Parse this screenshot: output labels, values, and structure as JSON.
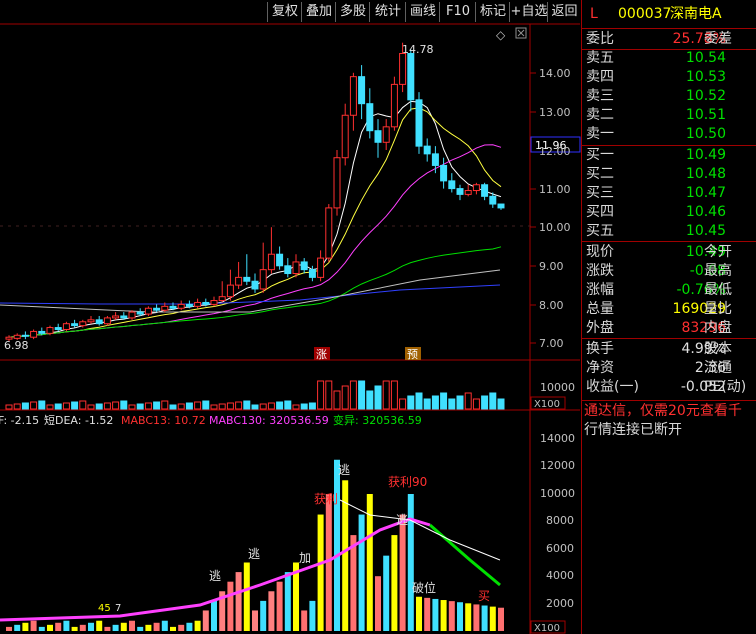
{
  "toolbar": {
    "buttons": [
      "复权",
      "叠加",
      "多股",
      "统计",
      "画线",
      "F10",
      "标记",
      "+自选",
      "返回"
    ]
  },
  "main_chart": {
    "high_label": "14.78",
    "low_label": "6.98",
    "current_price_tag": "11.96",
    "y_ticks": [
      "14.00",
      "13.00",
      "12.00",
      "11.00",
      "10.00",
      "9.00",
      "8.00",
      "7.00"
    ],
    "markers": [
      "涨",
      "预"
    ],
    "diamond": "◇"
  },
  "volume_chart": {
    "y_tick": "10000",
    "unit": "X100"
  },
  "indicator_chart": {
    "header": [
      "F: -2.15",
      "短DEA: -1.52",
      "MABC13: 10.72",
      "MABC130: 320536.59",
      "变异: 320536.59"
    ],
    "y_ticks": [
      "14000",
      "12000",
      "10000",
      "8000",
      "6000",
      "4000",
      "2000"
    ],
    "unit": "X100",
    "annotations": [
      "逃",
      "逃",
      "逃",
      "逃",
      "获利",
      "获利90",
      "加",
      "破位",
      "买",
      "45",
      "7"
    ]
  },
  "quote": {
    "header_letter": "L",
    "code": "000037",
    "name": "深南电A",
    "wei_bi_label": "委比",
    "wei_bi": "25.78%",
    "wei_cha_label": "委差",
    "sell": [
      {
        "label": "卖五",
        "price": "10.54"
      },
      {
        "label": "卖四",
        "price": "10.53"
      },
      {
        "label": "卖三",
        "price": "10.52"
      },
      {
        "label": "卖二",
        "price": "10.51"
      },
      {
        "label": "卖一",
        "price": "10.50"
      }
    ],
    "buy": [
      {
        "label": "买一",
        "price": "10.49"
      },
      {
        "label": "买二",
        "price": "10.48"
      },
      {
        "label": "买三",
        "price": "10.47"
      },
      {
        "label": "买四",
        "price": "10.46"
      },
      {
        "label": "买五",
        "price": "10.45"
      }
    ],
    "stats": [
      {
        "label": "现价",
        "value": "10.49",
        "right": "今开",
        "color": "#00e000"
      },
      {
        "label": "涨跌",
        "value": "-0.08",
        "right": "最高",
        "color": "#00e000"
      },
      {
        "label": "涨幅",
        "value": "-0.76%",
        "right": "最低",
        "color": "#00e000"
      },
      {
        "label": "总量",
        "value": "169029",
        "right": "量比",
        "color": "#ffff00"
      },
      {
        "label": "外盘",
        "value": "83296",
        "right": "内盘",
        "color": "#ff3030"
      }
    ],
    "stats2": [
      {
        "label": "换手",
        "value": "4.99%",
        "right": "股本"
      },
      {
        "label": "净资",
        "value": "2.36",
        "right": "流通"
      },
      {
        "label": "收益(一)",
        "value": "-0.052",
        "right": "PE(动)"
      }
    ],
    "notice": "通达信，仅需20元查看千",
    "status": "行情连接已断开"
  }
}
